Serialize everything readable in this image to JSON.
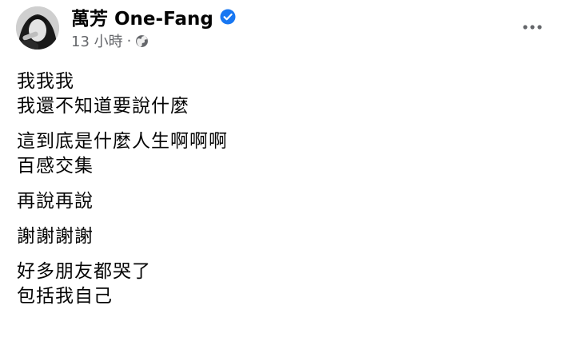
{
  "post": {
    "author_name": "萬芳 One-Fang",
    "timestamp": "13 小時",
    "separator": "·",
    "privacy_icon": "globe-icon",
    "verified_icon": "verified-badge-icon",
    "more_icon": "more-options-icon",
    "accent_color": "#1877f2",
    "paragraphs": [
      [
        "我我我",
        "我還不知道要說什麼"
      ],
      [
        "這到底是什麼人生啊啊啊",
        "百感交集"
      ],
      [
        "再說再說"
      ],
      [
        "謝謝謝謝"
      ],
      [
        "好多朋友都哭了",
        "包括我自己"
      ]
    ]
  }
}
